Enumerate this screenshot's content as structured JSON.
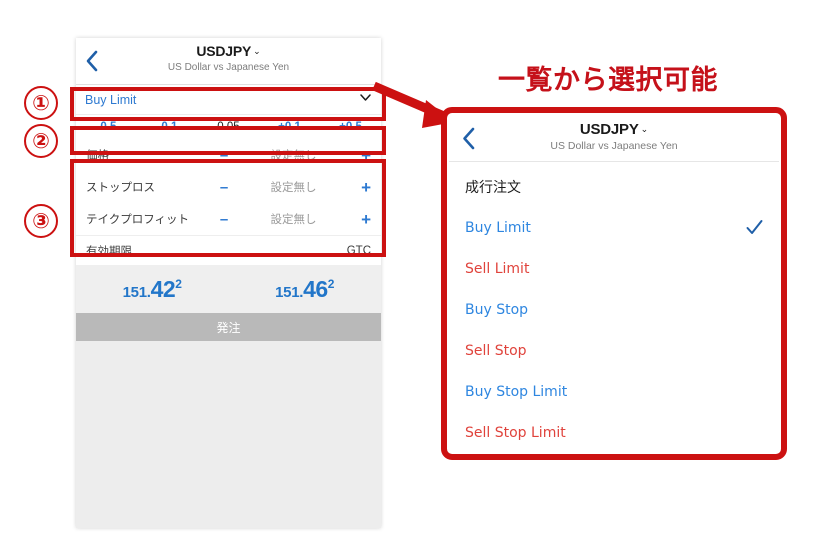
{
  "annotation": {
    "title": "一覧から選択可能",
    "steps": [
      "①",
      "②",
      "③"
    ],
    "accent_color": "#cc1111",
    "title_color": "#c5111a"
  },
  "order_screen": {
    "nav": {
      "back_icon": "back-chevron-icon",
      "symbol": "USDJPY",
      "caret": "⌄",
      "subtitle": "US Dollar vs Japanese Yen"
    },
    "order_type": {
      "value": "Buy Limit",
      "caret_icon": "chevron-down-icon"
    },
    "volume_steps": [
      {
        "label": "-0.5",
        "style": "accent"
      },
      {
        "label": "-0.1",
        "style": "accent"
      },
      {
        "label": "0.05",
        "style": "neutral"
      },
      {
        "label": "+0.1",
        "style": "accent"
      },
      {
        "label": "+0.5",
        "style": "accent"
      }
    ],
    "params": [
      {
        "name": "価格",
        "minus": "–",
        "value": "設定無し",
        "plus": "+"
      },
      {
        "name": "ストップロス",
        "minus": "–",
        "value": "設定無し",
        "plus": "+"
      },
      {
        "name": "テイクプロフィット",
        "minus": "–",
        "value": "設定無し",
        "plus": "+"
      }
    ],
    "expiry": {
      "label": "有効期限",
      "value": "GTC"
    },
    "quotes": [
      {
        "side": "bid",
        "int": "151.",
        "big": "42",
        "sup": "2"
      },
      {
        "side": "ask",
        "int": "151.",
        "big": "46",
        "sup": "2"
      }
    ],
    "submit_label": "発注",
    "submit_color": "#b9b9b9"
  },
  "order_type_list": {
    "nav": {
      "back_icon": "back-chevron-icon",
      "symbol": "USDJPY",
      "caret": "⌄",
      "subtitle": "US Dollar vs Japanese Yen"
    },
    "items": [
      {
        "label": "成行注文",
        "style": "market",
        "selected": false
      },
      {
        "label": "Buy Limit",
        "style": "buy",
        "selected": true
      },
      {
        "label": "Sell Limit",
        "style": "sell",
        "selected": false
      },
      {
        "label": "Buy Stop",
        "style": "buy",
        "selected": false
      },
      {
        "label": "Sell Stop",
        "style": "sell",
        "selected": false
      },
      {
        "label": "Buy Stop Limit",
        "style": "buy",
        "selected": false
      },
      {
        "label": "Sell Stop Limit",
        "style": "sell",
        "selected": false
      }
    ],
    "check_icon": "check-icon"
  }
}
